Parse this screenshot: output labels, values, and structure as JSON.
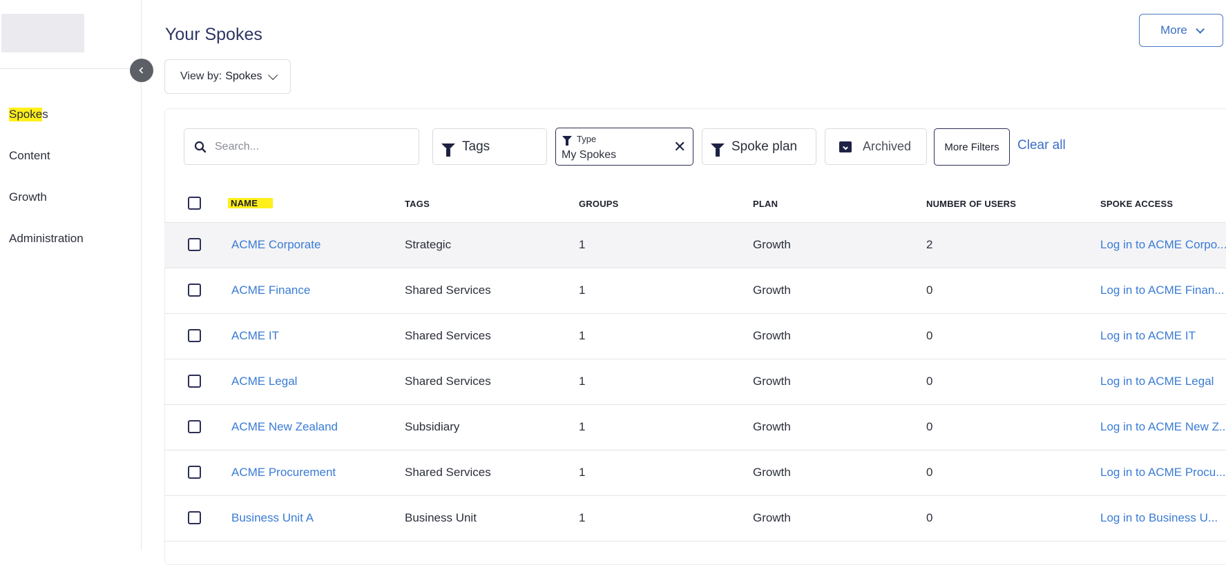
{
  "sidebar": {
    "nav": [
      {
        "label_a": "Spoke",
        "label_b": "s"
      },
      {
        "label": "Content"
      },
      {
        "label": "Growth"
      },
      {
        "label": "Administration"
      }
    ]
  },
  "header": {
    "title": "Your Spokes",
    "view_by_label": "View by:",
    "view_by_value": "Spokes",
    "more_label": "More"
  },
  "filters": {
    "search_placeholder": "Search...",
    "tags_label": "Tags",
    "type_label": "Type",
    "type_value": "My Spokes",
    "spoke_plan_label": "Spoke plan",
    "archived_label": "Archived",
    "more_filters_label": "More Filters",
    "clear_all_label": "Clear all"
  },
  "table": {
    "columns": [
      "NAME",
      "TAGS",
      "GROUPS",
      "PLAN",
      "NUMBER OF USERS",
      "SPOKE ACCESS"
    ],
    "rows": [
      {
        "name": "ACME Corporate",
        "tags": "Strategic",
        "groups": "1",
        "plan": "Growth",
        "users": "2",
        "access": "Log in to ACME Corpo..."
      },
      {
        "name": "ACME Finance",
        "tags": "Shared Services",
        "groups": "1",
        "plan": "Growth",
        "users": "0",
        "access": "Log in to ACME Finan..."
      },
      {
        "name": "ACME IT",
        "tags": "Shared Services",
        "groups": "1",
        "plan": "Growth",
        "users": "0",
        "access": "Log in to ACME IT"
      },
      {
        "name": "ACME Legal",
        "tags": "Shared Services",
        "groups": "1",
        "plan": "Growth",
        "users": "0",
        "access": "Log in to ACME Legal"
      },
      {
        "name": "ACME New Zealand",
        "tags": "Subsidiary",
        "groups": "1",
        "plan": "Growth",
        "users": "0",
        "access": "Log in to ACME New Z..."
      },
      {
        "name": "ACME Procurement",
        "tags": "Shared Services",
        "groups": "1",
        "plan": "Growth",
        "users": "0",
        "access": "Log in to ACME Procu..."
      },
      {
        "name": "Business Unit A",
        "tags": "Business Unit",
        "groups": "1",
        "plan": "Growth",
        "users": "0",
        "access": "Log in to Business U..."
      }
    ]
  },
  "colors": {
    "accent": "#3a7bd5",
    "title": "#2f3463",
    "highlight": "#ffef1a"
  }
}
